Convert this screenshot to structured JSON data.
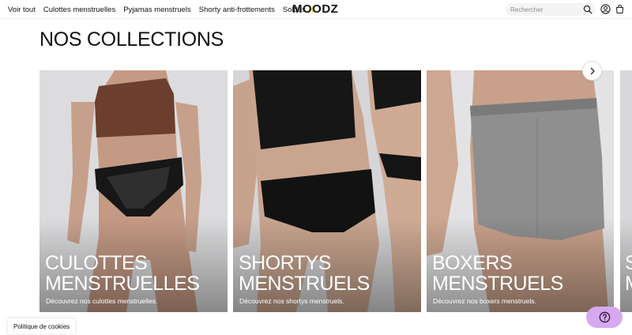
{
  "header": {
    "nav": [
      {
        "label": "Voir tout"
      },
      {
        "label": "Culottes menstruelles"
      },
      {
        "label": "Pyjamas menstruels"
      },
      {
        "label": "Shorty anti-frottements"
      },
      {
        "label": "Soldes"
      }
    ],
    "sale_sparkle": "✨",
    "logo": "MOODZ",
    "search_placeholder": "Rechercher",
    "icons": [
      "search-icon",
      "account-icon",
      "cart-icon"
    ]
  },
  "main": {
    "title": "NOS COLLECTIONS",
    "next_arrow": "chevron-right-icon",
    "cards": [
      {
        "title_line1": "CULOTTES",
        "title_line2": "MENSTRUELLES",
        "subtitle": "Découvrez nos culottes menstruelles."
      },
      {
        "title_line1": "SHORTYS",
        "title_line2": "MENSTRUELS",
        "subtitle": "Découvrez nos shortys menstruels."
      },
      {
        "title_line1": "BOXERS",
        "title_line2": "MENSTRUELS",
        "subtitle": "Découvrez nos boxers menstruels."
      },
      {
        "title_line1": "S",
        "title_line2": "M",
        "subtitle": ""
      }
    ]
  },
  "cookie": {
    "label": "Politique de cookies"
  },
  "help": {
    "icon": "help-icon"
  },
  "colors": {
    "help_bg": "#d7a8ef",
    "text": "#111111",
    "sale_sparkle": "#f2c94c"
  }
}
